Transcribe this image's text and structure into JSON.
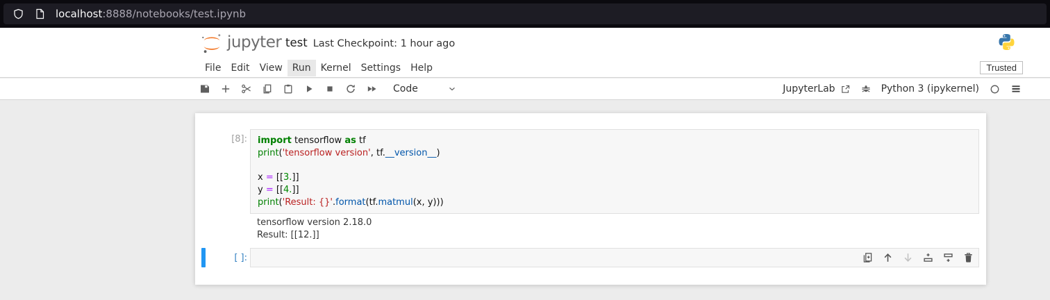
{
  "browser": {
    "url_host": "localhost",
    "url_path": ":8888/notebooks/test.ipynb",
    "icons": [
      "shield-permissions",
      "page-info"
    ]
  },
  "header": {
    "logo_text": "jupyter",
    "title": "test",
    "checkpoint": "Last Checkpoint: 1 hour ago",
    "kernel_logo": "python-logo"
  },
  "menu": {
    "items": [
      "File",
      "Edit",
      "View",
      "Run",
      "Kernel",
      "Settings",
      "Help"
    ],
    "active_item": "Run",
    "trusted_label": "Trusted"
  },
  "toolbar": {
    "left_icons": [
      "save",
      "insert-cell",
      "cut-cells",
      "copy-cells",
      "paste-cells",
      "run-cell",
      "interrupt-kernel",
      "restart-kernel",
      "restart-run-all"
    ],
    "cell_type": "Code",
    "jupyterlab_label": "JupyterLab",
    "right_icons": [
      "open-in-jupyterlab",
      "debugger",
      "kernel-status-idle",
      "main-menu"
    ],
    "kernel_name": "Python 3 (ipykernel)"
  },
  "notebook": {
    "code_cell": {
      "prompt": "[8]:",
      "code_lines": [
        [
          [
            "kw",
            "import"
          ],
          [
            "plain",
            " tensorflow "
          ],
          [
            "kw",
            "as"
          ],
          [
            "plain",
            " tf"
          ]
        ],
        [
          [
            "fn",
            "print"
          ],
          [
            "plain",
            "("
          ],
          [
            "str",
            "'tensorflow version'"
          ],
          [
            "plain",
            ", tf."
          ],
          [
            "prop",
            "__version__"
          ],
          [
            "plain",
            ")"
          ]
        ],
        [],
        [
          [
            "plain",
            "x "
          ],
          [
            "op",
            "="
          ],
          [
            "plain",
            " [["
          ],
          [
            "num",
            "3."
          ],
          [
            "plain",
            "]]"
          ]
        ],
        [
          [
            "plain",
            "y "
          ],
          [
            "op",
            "="
          ],
          [
            "plain",
            " [["
          ],
          [
            "num",
            "4."
          ],
          [
            "plain",
            "]]"
          ]
        ],
        [
          [
            "fn",
            "print"
          ],
          [
            "plain",
            "("
          ],
          [
            "str",
            "'Result: {}'"
          ],
          [
            "plain",
            "."
          ],
          [
            "prop",
            "format"
          ],
          [
            "plain",
            "(tf."
          ],
          [
            "prop",
            "matmul"
          ],
          [
            "plain",
            "(x, y)))"
          ]
        ]
      ],
      "outputs": [
        "tensorflow version 2.18.0",
        "Result: [[12.]]"
      ]
    },
    "empty_cell": {
      "prompt": "[ ]:",
      "toolbar_icons": [
        "duplicate-cell",
        "move-cell-up",
        "move-cell-down",
        "insert-cell-above",
        "insert-cell-below",
        "delete-cell"
      ]
    }
  },
  "colors": {
    "jupyter_orange": "#f37726",
    "selected_cell_bar": "#2196f3",
    "active_prompt_blue": "#307fc1",
    "inactive_prompt_gray": "#9e9e9e",
    "code_keyword": "#008000",
    "code_string": "#ba2121",
    "code_property": "#0055aa",
    "code_operator": "#aa22ff",
    "code_number": "#008800",
    "urlbar_bg": "#0b0a0f",
    "urlbar_field_bg": "#1d1c24"
  }
}
